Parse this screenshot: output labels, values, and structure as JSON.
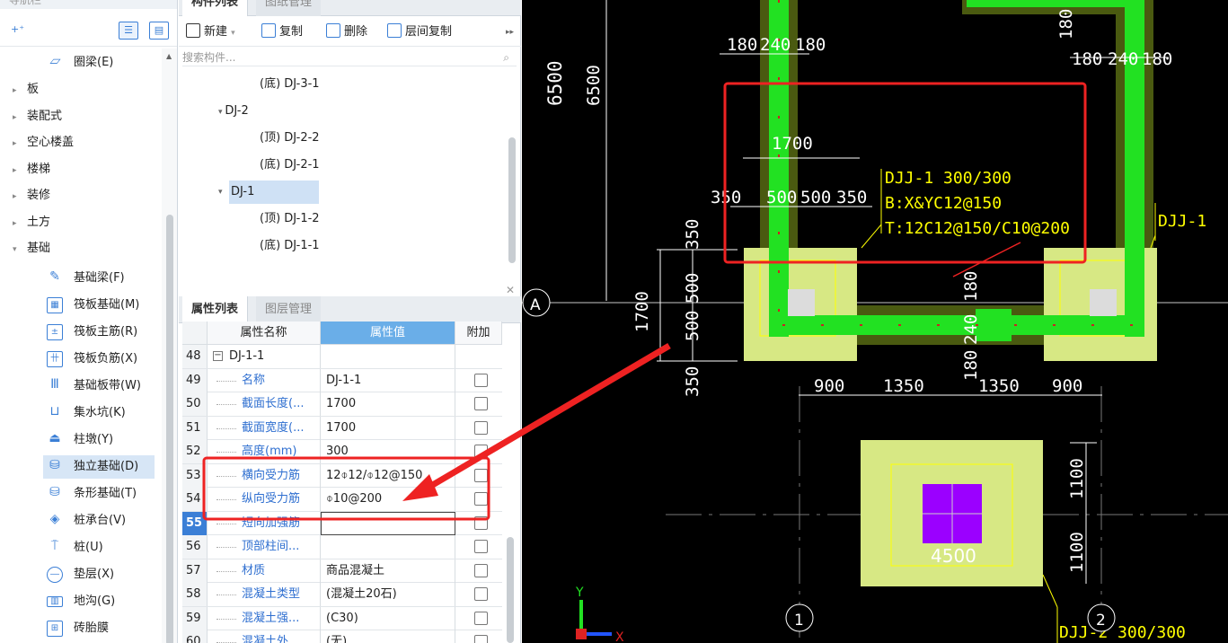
{
  "nav": {
    "title": "导航栏",
    "categories": [
      {
        "label": "板"
      },
      {
        "label": "装配式"
      },
      {
        "label": "空心楼盖"
      },
      {
        "label": "楼梯"
      },
      {
        "label": "装修"
      },
      {
        "label": "土方"
      },
      {
        "label": "基础"
      }
    ],
    "top_item": {
      "label": "圈梁(E)",
      "icon": "ring-beam-icon"
    },
    "items": [
      {
        "label": "基础梁(F)",
        "icon": "foundation-beam-icon"
      },
      {
        "label": "筏板基础(M)",
        "icon": "raft-foundation-icon"
      },
      {
        "label": "筏板主筋(R)",
        "icon": "raft-main-rebar-icon"
      },
      {
        "label": "筏板负筋(X)",
        "icon": "raft-negative-rebar-icon"
      },
      {
        "label": "基础板带(W)",
        "icon": "foundation-strip-icon"
      },
      {
        "label": "集水坑(K)",
        "icon": "sump-pit-icon"
      },
      {
        "label": "柱墩(Y)",
        "icon": "column-pier-icon"
      },
      {
        "label": "独立基础(D)",
        "icon": "isolated-footing-icon",
        "active": true
      },
      {
        "label": "条形基础(T)",
        "icon": "strip-footing-icon"
      },
      {
        "label": "桩承台(V)",
        "icon": "pile-cap-icon"
      },
      {
        "label": "桩(U)",
        "icon": "pile-icon"
      },
      {
        "label": "垫层(X)",
        "icon": "cushion-icon"
      },
      {
        "label": "地沟(G)",
        "icon": "trench-icon"
      },
      {
        "label": "砖胎膜",
        "icon": "brick-mold-icon"
      }
    ]
  },
  "component_list": {
    "tabs": [
      "构件列表",
      "图纸管理"
    ],
    "toolbar": {
      "new": "新建",
      "copy": "复制",
      "delete": "删除",
      "floor_copy": "层间复制"
    },
    "search_placeholder": "搜索构件...",
    "tree": [
      {
        "label": "(底) DJ-3-1",
        "level": 2
      },
      {
        "label": "DJ-2",
        "level": 1
      },
      {
        "label": "(顶) DJ-2-2",
        "level": 2
      },
      {
        "label": "(底) DJ-2-1",
        "level": 2
      },
      {
        "label": "DJ-1",
        "level": 1,
        "selected": true
      },
      {
        "label": "(顶) DJ-1-2",
        "level": 2
      },
      {
        "label": "(底) DJ-1-1",
        "level": 2
      }
    ]
  },
  "properties": {
    "tabs": [
      "属性列表",
      "图层管理"
    ],
    "headers": {
      "name": "属性名称",
      "value": "属性值",
      "extra": "附加"
    },
    "rows": [
      {
        "num": "48",
        "name": "DJ-1-1",
        "value": "",
        "group": true
      },
      {
        "num": "49",
        "name": "名称",
        "value": "DJ-1-1",
        "checkbox": false
      },
      {
        "num": "50",
        "name": "截面长度(...",
        "value": "1700",
        "checkbox": true
      },
      {
        "num": "51",
        "name": "截面宽度(...",
        "value": "1700",
        "checkbox": true
      },
      {
        "num": "52",
        "name": "高度(mm)",
        "value": "300",
        "checkbox": true
      },
      {
        "num": "53",
        "name": "横向受力筋",
        "value": "12⌽12/⌽12@150",
        "checkbox": true
      },
      {
        "num": "54",
        "name": "纵向受力筋",
        "value": "⌽10@200",
        "checkbox": true
      },
      {
        "num": "55",
        "name": "短向加强筋",
        "value": "",
        "checkbox": true,
        "active": true
      },
      {
        "num": "56",
        "name": "顶部柱间...",
        "value": "",
        "checkbox": true
      },
      {
        "num": "57",
        "name": "材质",
        "value": "商品混凝土",
        "checkbox": true
      },
      {
        "num": "58",
        "name": "混凝土类型",
        "value": "(混凝土20石)",
        "checkbox": true
      },
      {
        "num": "59",
        "name": "混凝土强...",
        "value": "(C30)",
        "checkbox": true
      },
      {
        "num": "60",
        "name": "混凝土外...",
        "value": "(无)",
        "checkbox": false
      }
    ]
  },
  "cad": {
    "dims_top_left": [
      "180",
      "240",
      "180"
    ],
    "dims_top_right": [
      "180",
      "240",
      "180"
    ],
    "dim_6500": "6500",
    "dim_1700_top": "1700",
    "dims_mid": [
      "350",
      "500",
      "500",
      "350"
    ],
    "footing_label_lines": [
      "DJJ-1 300/300",
      "B:X&YC12@150",
      "T:12C12@150/C10@200"
    ],
    "djj_label_right": "DJJ-1",
    "axis_a": "A",
    "dims_left_vert": [
      "350",
      "500",
      "500",
      "350"
    ],
    "dim_1700_left": "1700",
    "dims_bottom": [
      "900",
      "1350",
      "1350",
      "900"
    ],
    "beam_dims": [
      "180",
      "240",
      "180"
    ],
    "dim_1100_a": "1100",
    "dim_1100_b": "1100",
    "dim_4500": "4500",
    "dim_180_right": "180",
    "axis_1": "1",
    "axis_2": "2",
    "bottom_label": "DJJ-2 300/300",
    "axis_y": "Y",
    "axis_x": "X",
    "colors": {
      "bg": "#000000",
      "beam": "#22e122",
      "beam_dark": "#4a5a10",
      "footing": "#d7e884",
      "column": "#9b00ff",
      "dim": "#ffffff",
      "label": "#ffff00",
      "annotation": "#ee2222"
    }
  }
}
